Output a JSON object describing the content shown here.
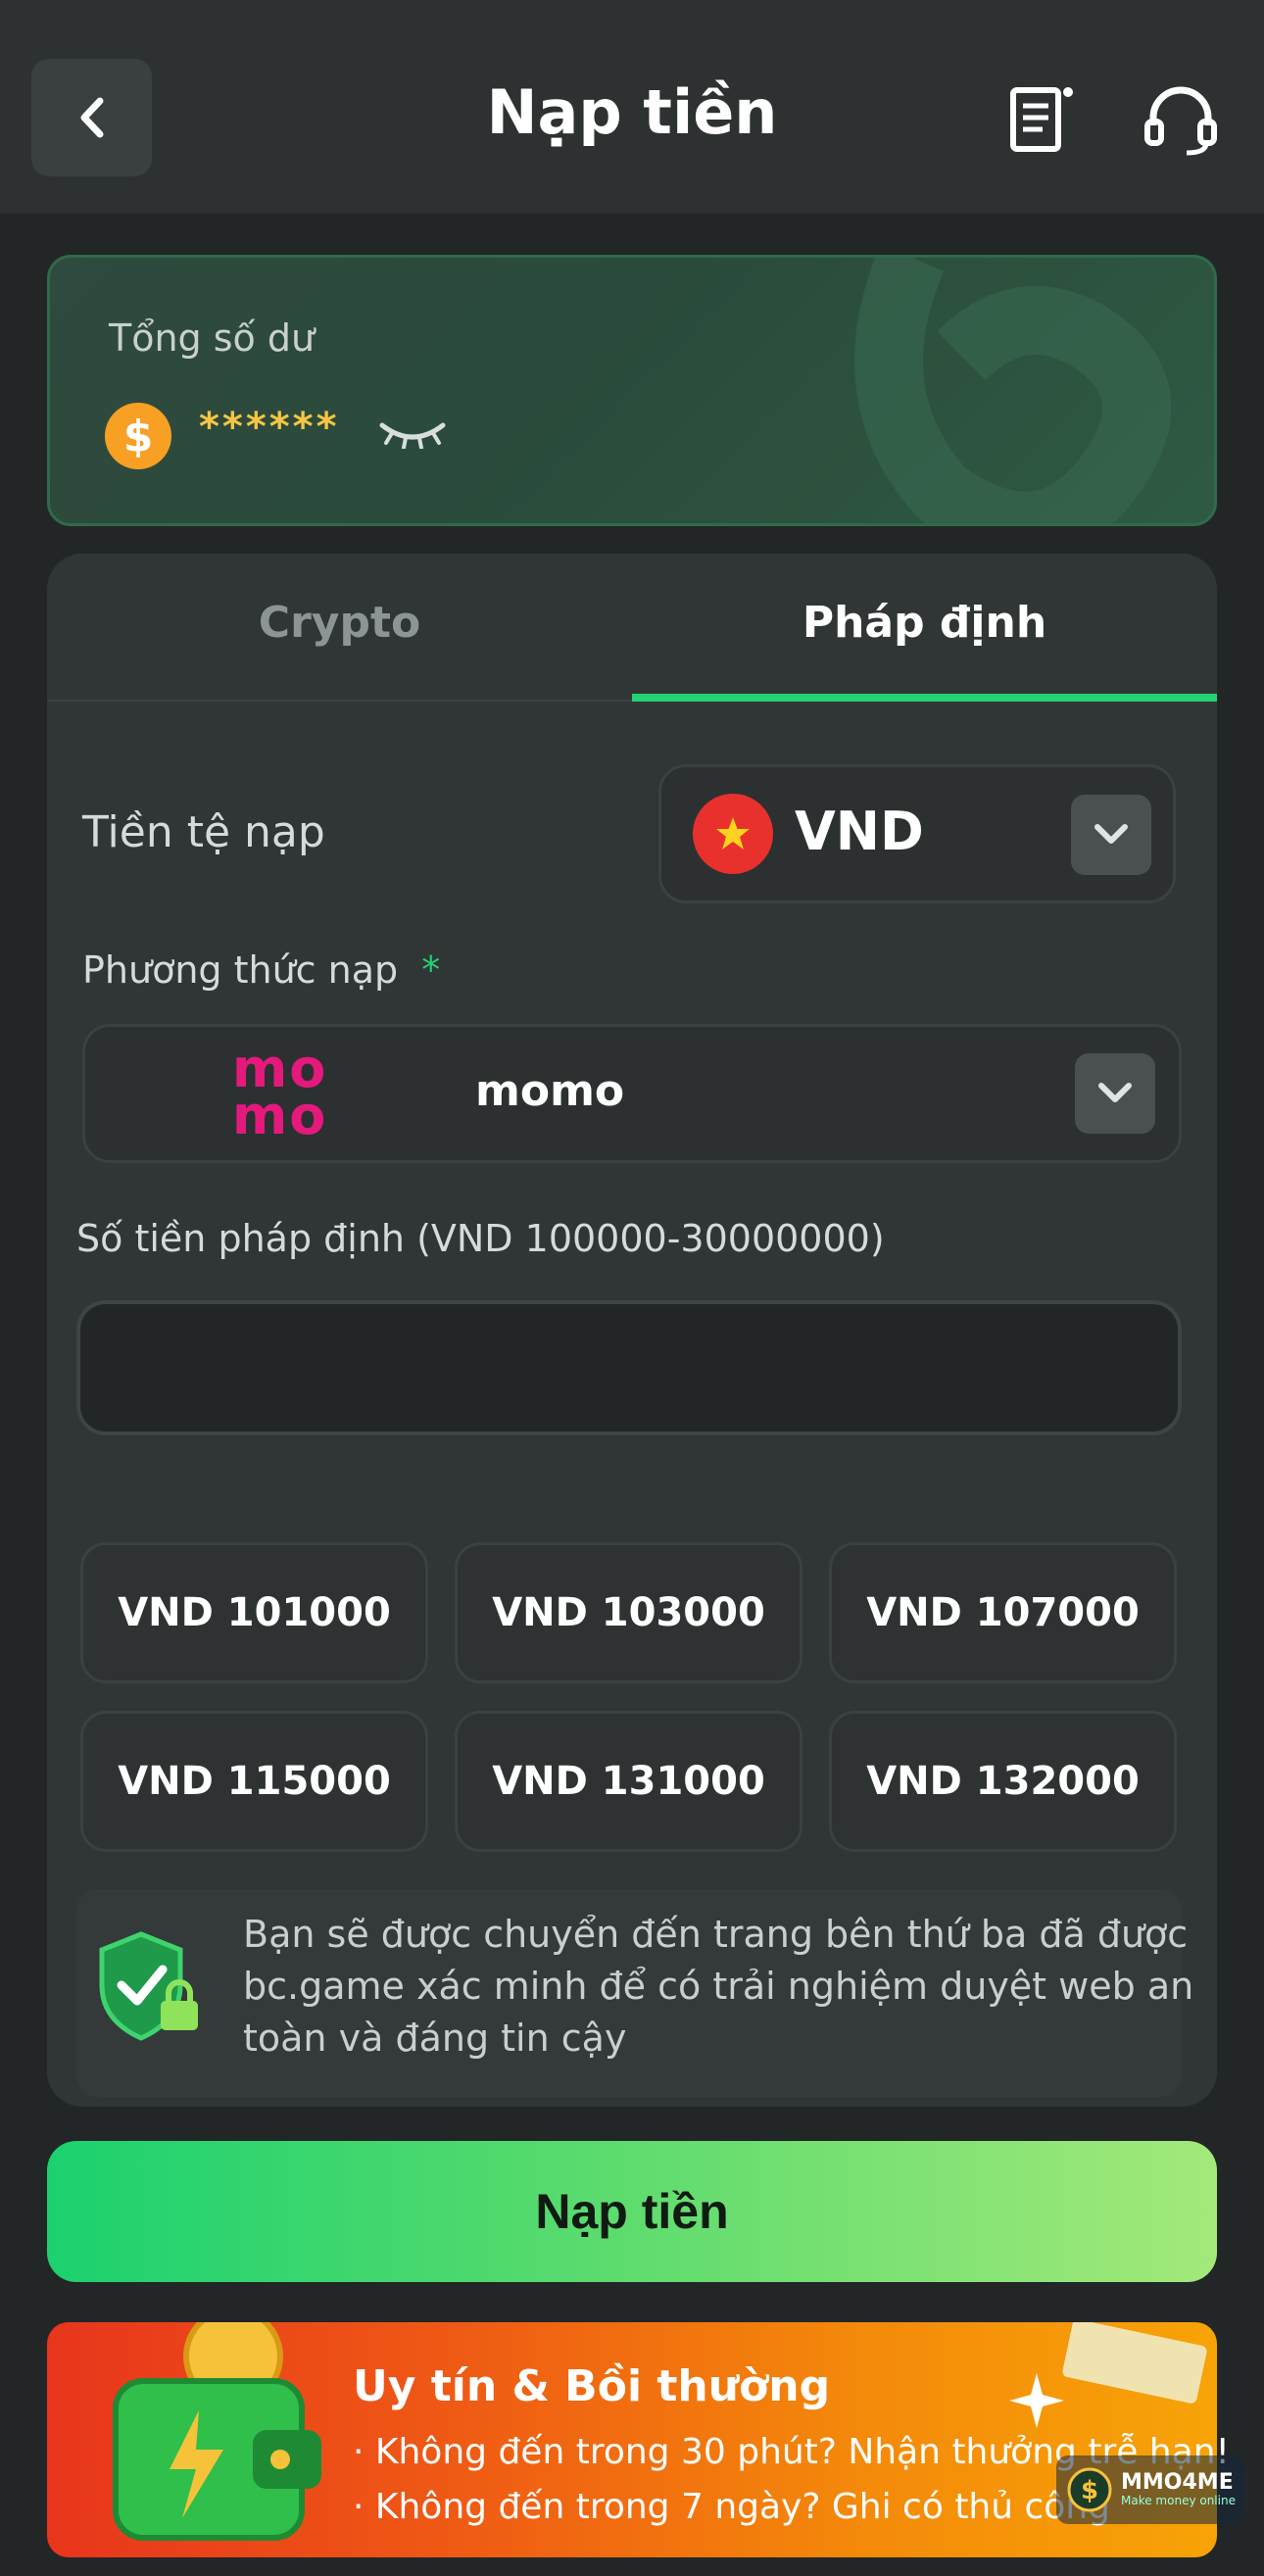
{
  "header": {
    "title": "Nạp tiền",
    "back_icon": "chevron-left-icon",
    "history_icon": "receipt-icon",
    "support_icon": "headset-icon"
  },
  "balance": {
    "label": "Tổng số dư",
    "masked_value": "******",
    "coin_symbol": "$"
  },
  "tabs": [
    {
      "label": "Crypto",
      "active": false
    },
    {
      "label": "Pháp định",
      "active": true
    }
  ],
  "currency": {
    "label": "Tiền tệ nạp",
    "value": "VND"
  },
  "method": {
    "label": "Phương thức nạp",
    "required_mark": "*",
    "logo_text_top": "mo",
    "logo_text_bottom": "mo",
    "value": "momo"
  },
  "amount": {
    "label": "Số tiền pháp định (VND 100000-30000000)",
    "value": "",
    "placeholder": ""
  },
  "presets": [
    "VND 101000",
    "VND 103000",
    "VND 107000",
    "VND 115000",
    "VND 131000",
    "VND 132000"
  ],
  "info": {
    "text": "Bạn sẽ được chuyển đến trang bên thứ ba đã được bc.game xác minh để có trải nghiệm duyệt web an toàn và đáng tin cậy"
  },
  "submit_label": "Nạp tiền",
  "promo": {
    "title": "Uy tín & Bồi thường",
    "lines": [
      "· Không đến trong 30 phút? Nhận thưởng trễ hạn!",
      "· Không đến trong 7 ngày? Ghi có thủ công"
    ]
  },
  "watermark": {
    "text": "MMO4ME",
    "sub": "Make money online"
  },
  "colors": {
    "accent_green": "#24d173",
    "background": "#232626",
    "panel": "#303535",
    "coin": "#f7a024",
    "momo_pink": "#e5197d"
  }
}
